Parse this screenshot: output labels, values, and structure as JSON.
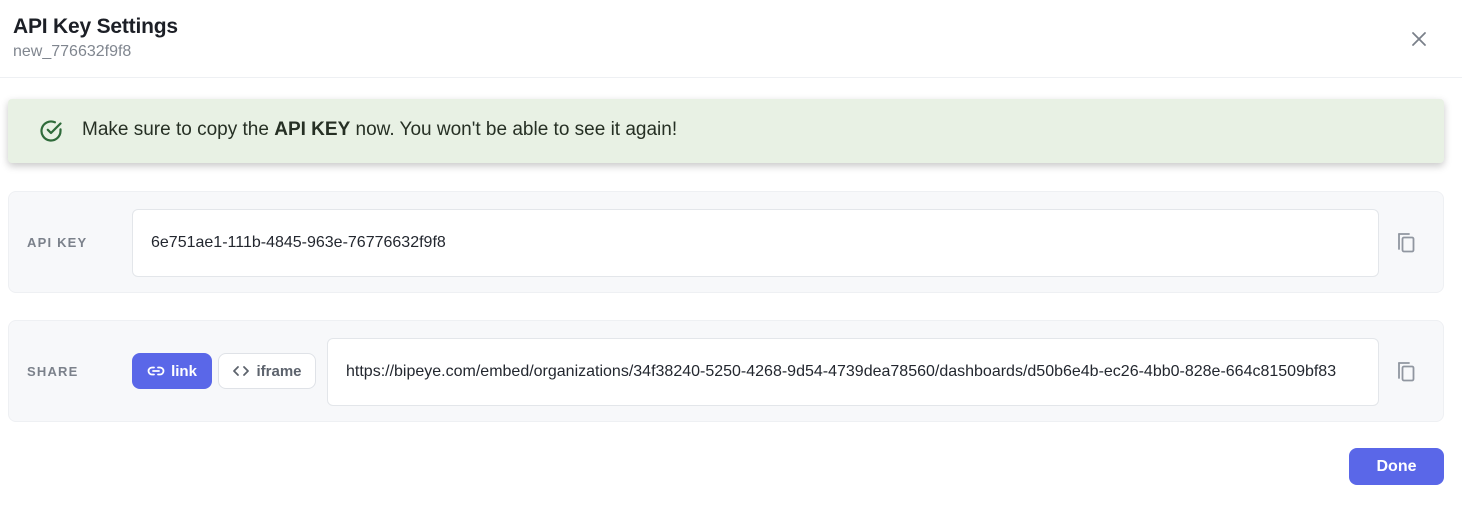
{
  "dialog": {
    "title": "API Key Settings",
    "subtitle": "new_776632f9f8",
    "close_icon": "close-icon"
  },
  "alert": {
    "icon": "check-circle-icon",
    "text_before": "Make sure to copy the ",
    "text_bold": "API KEY",
    "text_after": " now. You won't be able to see it again!",
    "background": "#e8f1e4"
  },
  "api_key": {
    "label": "API KEY",
    "value": "6e751ae1-111b-4845-963e-76776632f9f8",
    "copy_icon": "copy-icon"
  },
  "share": {
    "label": "SHARE",
    "tabs": [
      {
        "label": "link",
        "icon": "link-icon",
        "active": true
      },
      {
        "label": "iframe",
        "icon": "code-icon",
        "active": false
      }
    ],
    "value": "https://bipeye.com/embed/organizations/34f38240-5250-4268-9d54-4739dea78560/dashboards/d50b6e4b-ec26-4bb0-828e-664c81509bf83",
    "copy_icon": "copy-icon"
  },
  "footer": {
    "done_label": "Done"
  },
  "colors": {
    "accent": "#5a67e8",
    "alert_icon": "#2f6b3a"
  }
}
